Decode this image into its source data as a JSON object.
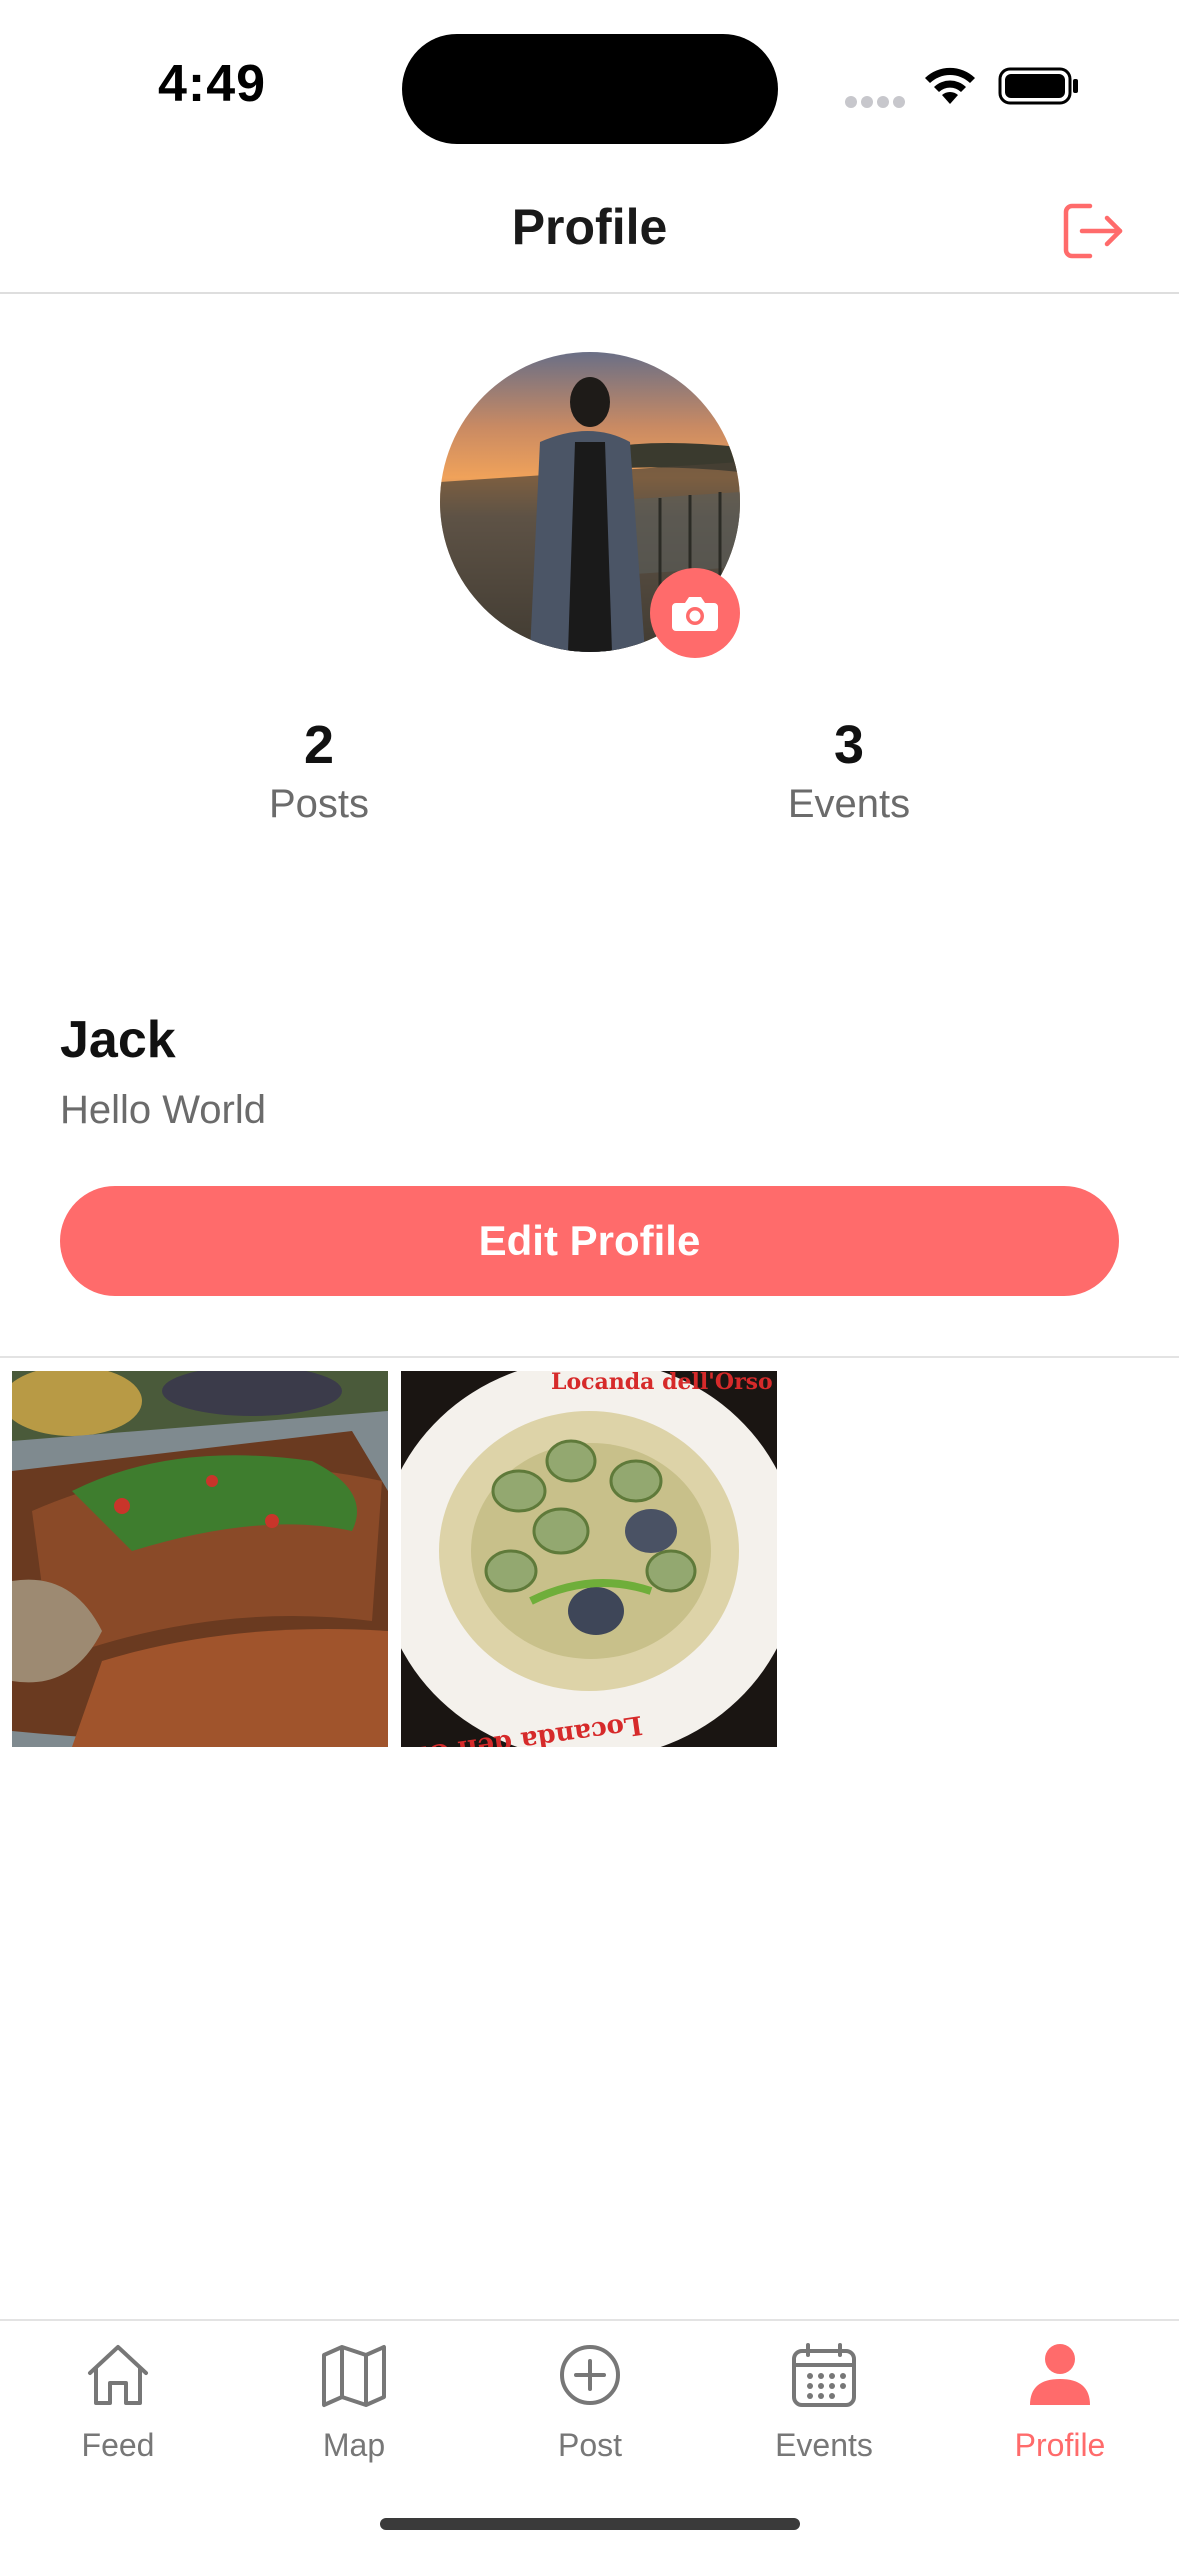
{
  "status_bar": {
    "time": "4:49"
  },
  "header": {
    "title": "Profile",
    "logout_icon": "logout-icon"
  },
  "profile": {
    "avatar_icon": "avatar-photo",
    "camera_icon": "camera-icon",
    "stats": [
      {
        "value": "2",
        "label": "Posts"
      },
      {
        "value": "3",
        "label": "Events"
      }
    ],
    "name": "Jack",
    "bio": "Hello World",
    "edit_label": "Edit Profile"
  },
  "posts": [
    {
      "alt": "steak-photo",
      "plate_text": ""
    },
    {
      "alt": "ravioli-photo",
      "plate_text": "Locanda dell'Orso"
    }
  ],
  "tabs": [
    {
      "label": "Feed",
      "icon": "home-icon",
      "active": false
    },
    {
      "label": "Map",
      "icon": "map-icon",
      "active": false
    },
    {
      "label": "Post",
      "icon": "plus-circle-icon",
      "active": false
    },
    {
      "label": "Events",
      "icon": "calendar-icon",
      "active": false
    },
    {
      "label": "Profile",
      "icon": "person-icon",
      "active": true
    }
  ],
  "colors": {
    "accent": "#ff6b6b",
    "text_secondary": "#6b6b6b",
    "tab_inactive": "#777777"
  }
}
